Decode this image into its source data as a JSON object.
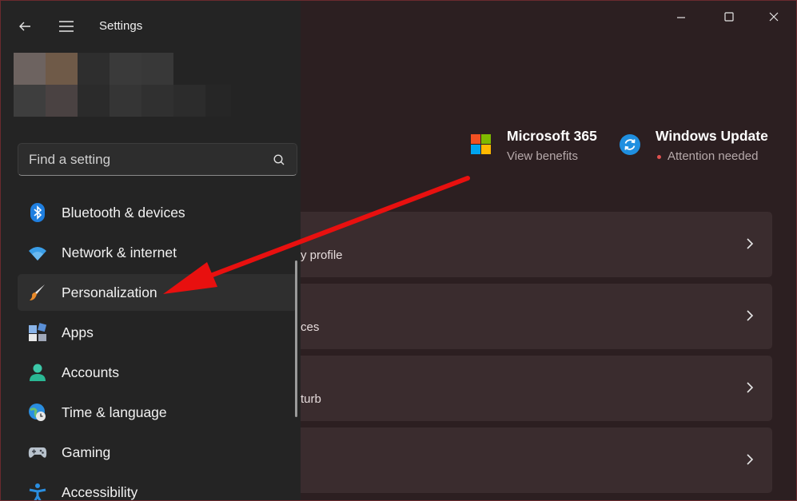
{
  "window": {
    "title": "Settings"
  },
  "search": {
    "placeholder": "Find a setting",
    "value": ""
  },
  "sidebar": {
    "items": [
      {
        "label": "Bluetooth & devices",
        "icon": "bluetooth-icon",
        "selected": false
      },
      {
        "label": "Network & internet",
        "icon": "wifi-icon",
        "selected": false
      },
      {
        "label": "Personalization",
        "icon": "paintbrush-icon",
        "selected": true
      },
      {
        "label": "Apps",
        "icon": "apps-icon",
        "selected": false
      },
      {
        "label": "Accounts",
        "icon": "person-icon",
        "selected": false
      },
      {
        "label": "Time & language",
        "icon": "globe-clock-icon",
        "selected": false
      },
      {
        "label": "Gaming",
        "icon": "gamepad-icon",
        "selected": false
      },
      {
        "label": "Accessibility",
        "icon": "accessibility-icon",
        "selected": false
      }
    ]
  },
  "header_tiles": {
    "microsoft365": {
      "title": "Microsoft 365",
      "subtitle": "View benefits"
    },
    "windows_update": {
      "title": "Windows Update",
      "subtitle": "Attention needed"
    }
  },
  "cards": [
    {
      "partial_text": "y profile"
    },
    {
      "partial_text": "ces"
    },
    {
      "partial_text": "turb"
    },
    {
      "partial_text": ""
    }
  ],
  "colors": {
    "accent_annotation": "#e8100f",
    "drawer_bg": "#242424",
    "content_bg": "#2c1f21",
    "attention_dot": "#e0514f"
  }
}
